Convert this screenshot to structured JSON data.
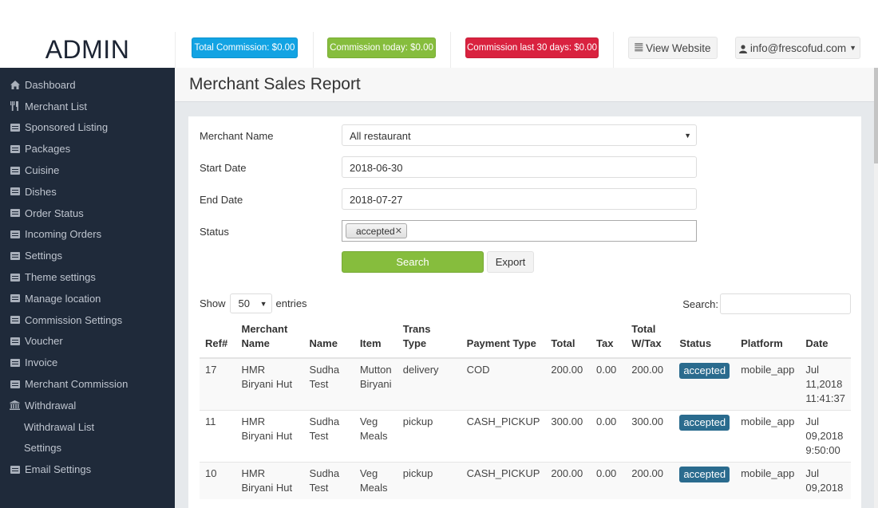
{
  "brand": "ADMIN",
  "topbar": {
    "total_commission": "Total Commission: $0.00",
    "commission_today": "Commission today: $0.00",
    "commission_30_days": "Commission last 30 days: $0.00",
    "view_website": "View Website",
    "user_email": "info@frescofud.com",
    "colors": {
      "blue": "#12a3e3",
      "green": "#86bd3d",
      "red": "#d9223f"
    }
  },
  "sidebar": {
    "items": [
      {
        "label": "Dashboard",
        "icon": "home-icon"
      },
      {
        "label": "Merchant List",
        "icon": "cutlery-icon"
      },
      {
        "label": "Sponsored Listing",
        "icon": "list-icon"
      },
      {
        "label": "Packages",
        "icon": "list-icon"
      },
      {
        "label": "Cuisine",
        "icon": "list-icon"
      },
      {
        "label": "Dishes",
        "icon": "list-icon"
      },
      {
        "label": "Order Status",
        "icon": "list-icon"
      },
      {
        "label": "Incoming Orders",
        "icon": "list-icon"
      },
      {
        "label": "Settings",
        "icon": "list-icon"
      },
      {
        "label": "Theme settings",
        "icon": "list-icon"
      },
      {
        "label": "Manage location",
        "icon": "list-icon"
      },
      {
        "label": "Commission Settings",
        "icon": "list-icon"
      },
      {
        "label": "Voucher",
        "icon": "list-icon"
      },
      {
        "label": "Invoice",
        "icon": "list-icon"
      },
      {
        "label": "Merchant Commission",
        "icon": "list-icon"
      },
      {
        "label": "Withdrawal",
        "icon": "bank-icon"
      },
      {
        "label": "Withdrawal List",
        "icon": ""
      },
      {
        "label": "Settings",
        "icon": ""
      },
      {
        "label": "Email Settings",
        "icon": "list-icon"
      }
    ]
  },
  "page": {
    "title": "Merchant Sales Report"
  },
  "form": {
    "merchant_label": "Merchant Name",
    "merchant_value": "All restaurant",
    "start_label": "Start Date",
    "start_value": "2018-06-30",
    "end_label": "End Date",
    "end_value": "2018-07-27",
    "status_label": "Status",
    "status_chip": "accepted",
    "search_button": "Search",
    "export_button": "Export"
  },
  "table_controls": {
    "show_label": "Show",
    "entries_value": "50",
    "entries_label": "entries",
    "search_label": "Search:",
    "search_value": ""
  },
  "table": {
    "headers": [
      "Ref#",
      "Merchant Name",
      "Name",
      "Item",
      "Trans Type",
      "Payment Type",
      "Total",
      "Tax",
      "Total W/Tax",
      "Status",
      "Platform",
      "Date"
    ],
    "rows": [
      {
        "ref": "17",
        "merchant": "HMR Biryani Hut",
        "name": "Sudha Test",
        "item": "Mutton Biryani",
        "trans_type": "delivery",
        "payment_type": "COD",
        "total": "200.00",
        "tax": "0.00",
        "total_wtax": "200.00",
        "status": "accepted",
        "platform": "mobile_app",
        "date": "Jul 11,2018 11:41:37"
      },
      {
        "ref": "11",
        "merchant": "HMR Biryani Hut",
        "name": "Sudha Test",
        "item": "Veg Meals",
        "trans_type": "pickup",
        "payment_type": "CASH_PICKUP",
        "total": "300.00",
        "tax": "0.00",
        "total_wtax": "300.00",
        "status": "accepted",
        "platform": "mobile_app",
        "date": "Jul 09,2018 9:50:00"
      },
      {
        "ref": "10",
        "merchant": "HMR Biryani Hut",
        "name": "Sudha Test",
        "item": "Veg Meals",
        "trans_type": "pickup",
        "payment_type": "CASH_PICKUP",
        "total": "200.00",
        "tax": "0.00",
        "total_wtax": "200.00",
        "status": "accepted",
        "platform": "mobile_app",
        "date": "Jul 09,2018"
      }
    ]
  }
}
